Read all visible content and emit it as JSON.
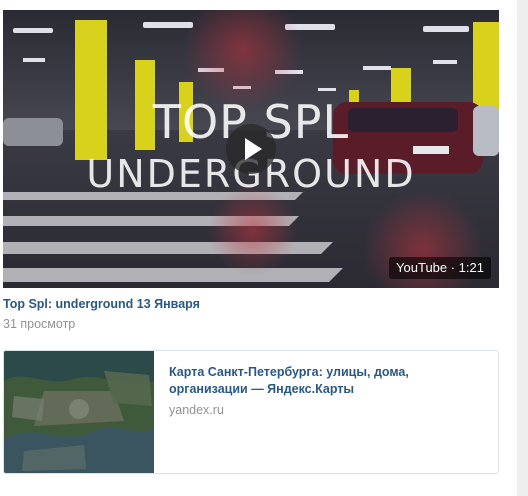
{
  "video": {
    "overlay_title_line1": "TOP SPL",
    "overlay_title_line2": "UNDERGROUND",
    "duration_badge": "YouTube · 1:21",
    "title": "Top Spl: underground 13 Января",
    "views": "31 просмотр"
  },
  "link_card": {
    "title": "Карта Санкт-Петербурга: улицы, дома, организации — Яндекс.Карты",
    "domain": "yandex.ru"
  },
  "icons": {
    "play": "play-icon"
  },
  "colors": {
    "link": "#2a5885",
    "muted": "#939393",
    "page_bg": "#edeef0",
    "pillar_yellow": "#d9d21d"
  }
}
